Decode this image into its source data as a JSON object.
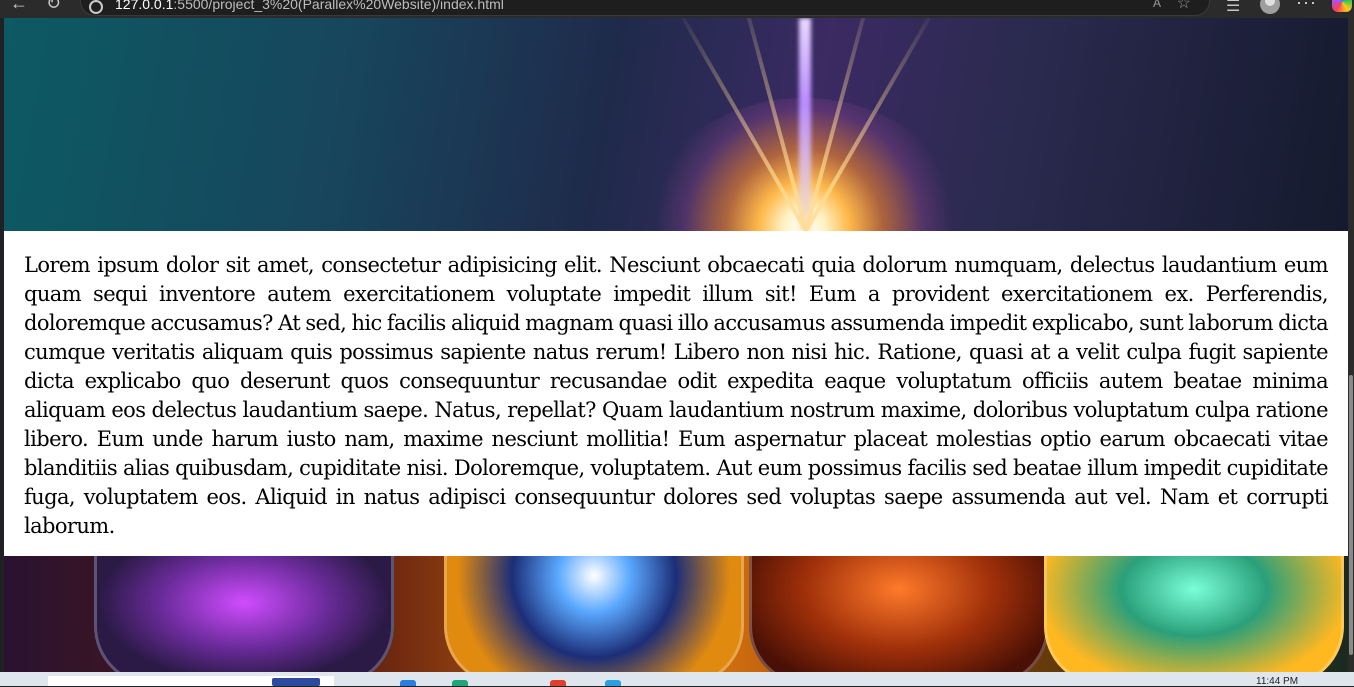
{
  "browser": {
    "url_host": "127.0.0.1",
    "url_path": ":5500/project_3%20(Parallex%20Website)/index.html",
    "read_aloud_label": "A",
    "menu_label": "···"
  },
  "page": {
    "paragraph": "Lorem ipsum dolor sit amet, consectetur adipisicing elit. Nesciunt obcaecati quia dolorum numquam, delectus laudantium eum quam sequi inventore autem exercitationem voluptate impedit illum sit! Eum a provident exercitationem ex. Perferendis, doloremque accusamus? At sed, hic facilis aliquid magnam quasi illo accusamus assumenda impedit explicabo, sunt laborum dicta cumque veritatis aliquam quis possimus sapiente natus rerum! Libero non nisi hic. Ratione, quasi at a velit culpa fugit sapiente dicta explicabo quo deserunt quos consequuntur recusandae odit expedita eaque voluptatum officiis autem beatae minima aliquam eos delectus laudantium saepe. Natus, repellat? Quam laudantium nostrum maxime, doloribus voluptatum culpa ratione libero. Eum unde harum iusto nam, maxime nesciunt mollitia! Eum aspernatur placeat molestias optio earum obcaecati vitae blanditiis alias quibusdam, cupiditate nisi. Doloremque, voluptatem. Aut eum possimus facilis sed beatae illum impedit cupiditate fuga, voluptatem eos. Aliquid in natus adipisci consequuntur dolores sed voluptas saepe assumenda aut vel. Nam et corrupti laborum."
  },
  "taskbar": {
    "clock": "11:44 PM"
  },
  "icons": {
    "back": "arrow-left-icon",
    "reload": "reload-icon",
    "info": "info-icon",
    "favorite": "star-icon",
    "collections": "collections-icon",
    "profile": "profile-icon",
    "menu": "more-icon",
    "copilot": "copilot-icon"
  },
  "colors": {
    "page_background": "#ffffff",
    "text": "#000000",
    "browser_chrome": "#2b2b2b"
  }
}
